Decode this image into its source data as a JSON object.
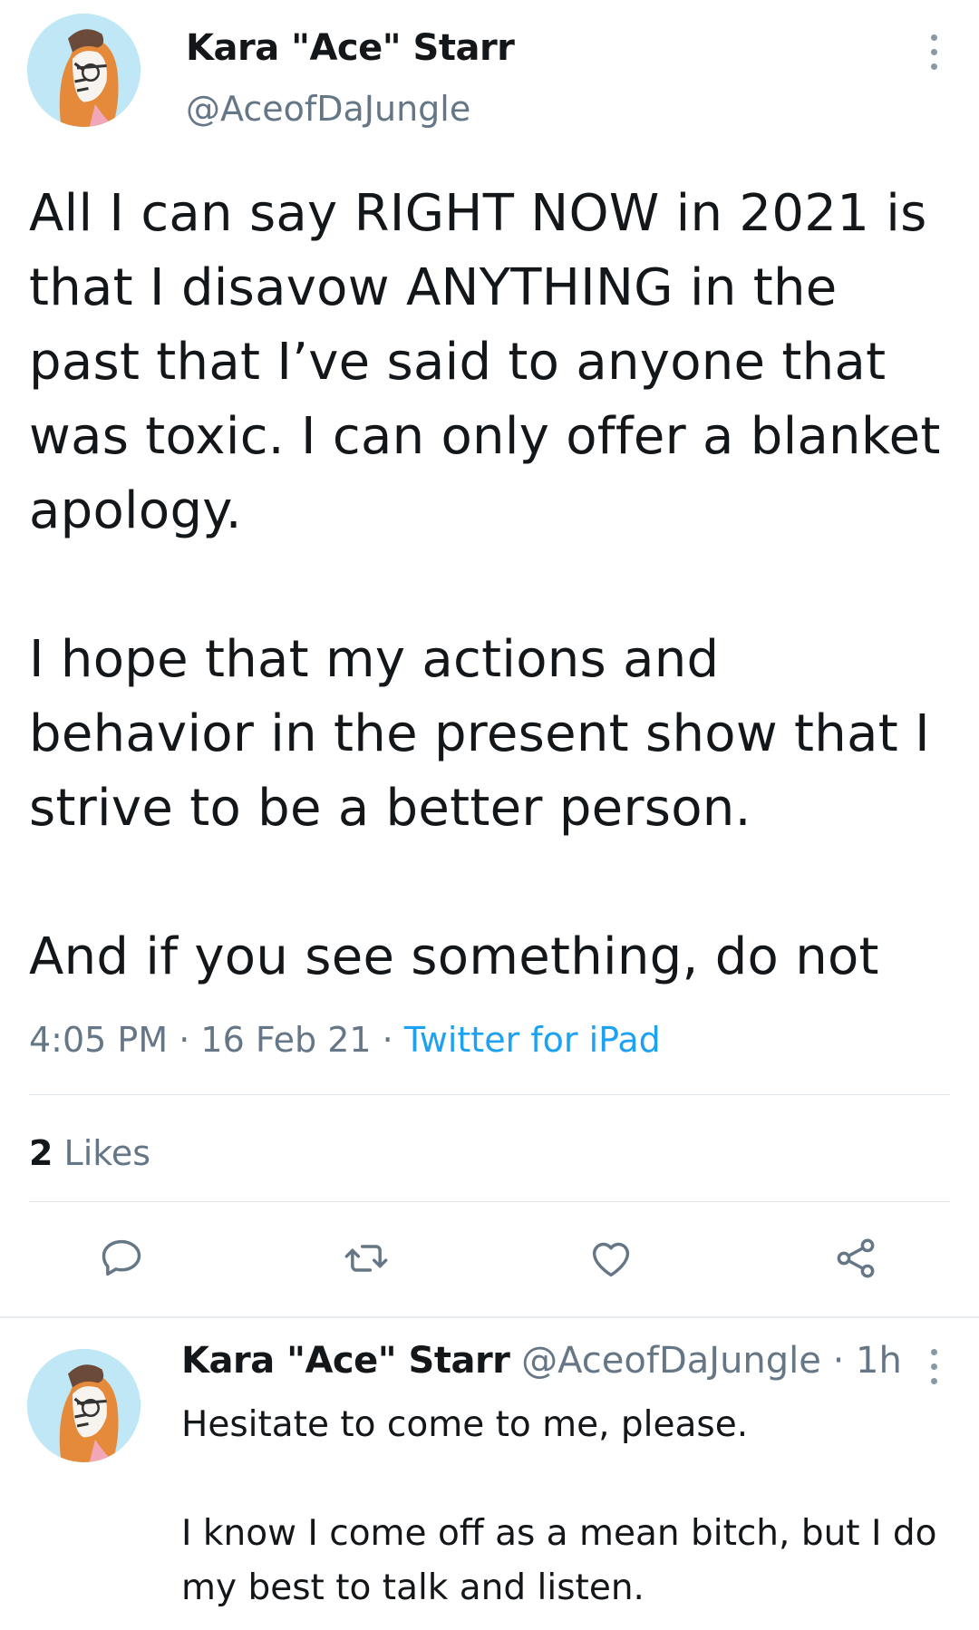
{
  "tweet": {
    "author_name": "Kara \"Ace\" Starr",
    "author_handle": "@AceofDaJungle",
    "text": "All I can say RIGHT NOW in 2021 is that I disavow ANYTHING in the past that I’ve said to anyone that was toxic. I can only offer a blanket apology.\n\nI hope that my actions and behavior in the present show that I strive to be a better person.\n\nAnd if you see something, do not",
    "time": "4:05 PM",
    "date": "16 Feb 21",
    "source": "Twitter for iPad",
    "separator": "·",
    "likes_count": "2",
    "likes_label": "Likes",
    "menu_icon": "more-vertical-icon"
  },
  "actions": {
    "reply_icon": "reply-icon",
    "retweet_icon": "retweet-icon",
    "like_icon": "heart-icon",
    "share_icon": "share-icon"
  },
  "reply": {
    "author_name": "Kara \"Ace\" Starr",
    "author_handle": "@AceofDaJungle",
    "separator": "·",
    "time": "1h",
    "text": "Hesitate to come to me, please.\n\nI know I come off as a mean bitch, but I do my best to talk and listen.",
    "menu_icon": "more-vertical-icon"
  },
  "colors": {
    "accent": "#1da1f2",
    "secondary_text": "#657786",
    "icon_gray": "#657786",
    "divider": "#e1e8ed"
  }
}
